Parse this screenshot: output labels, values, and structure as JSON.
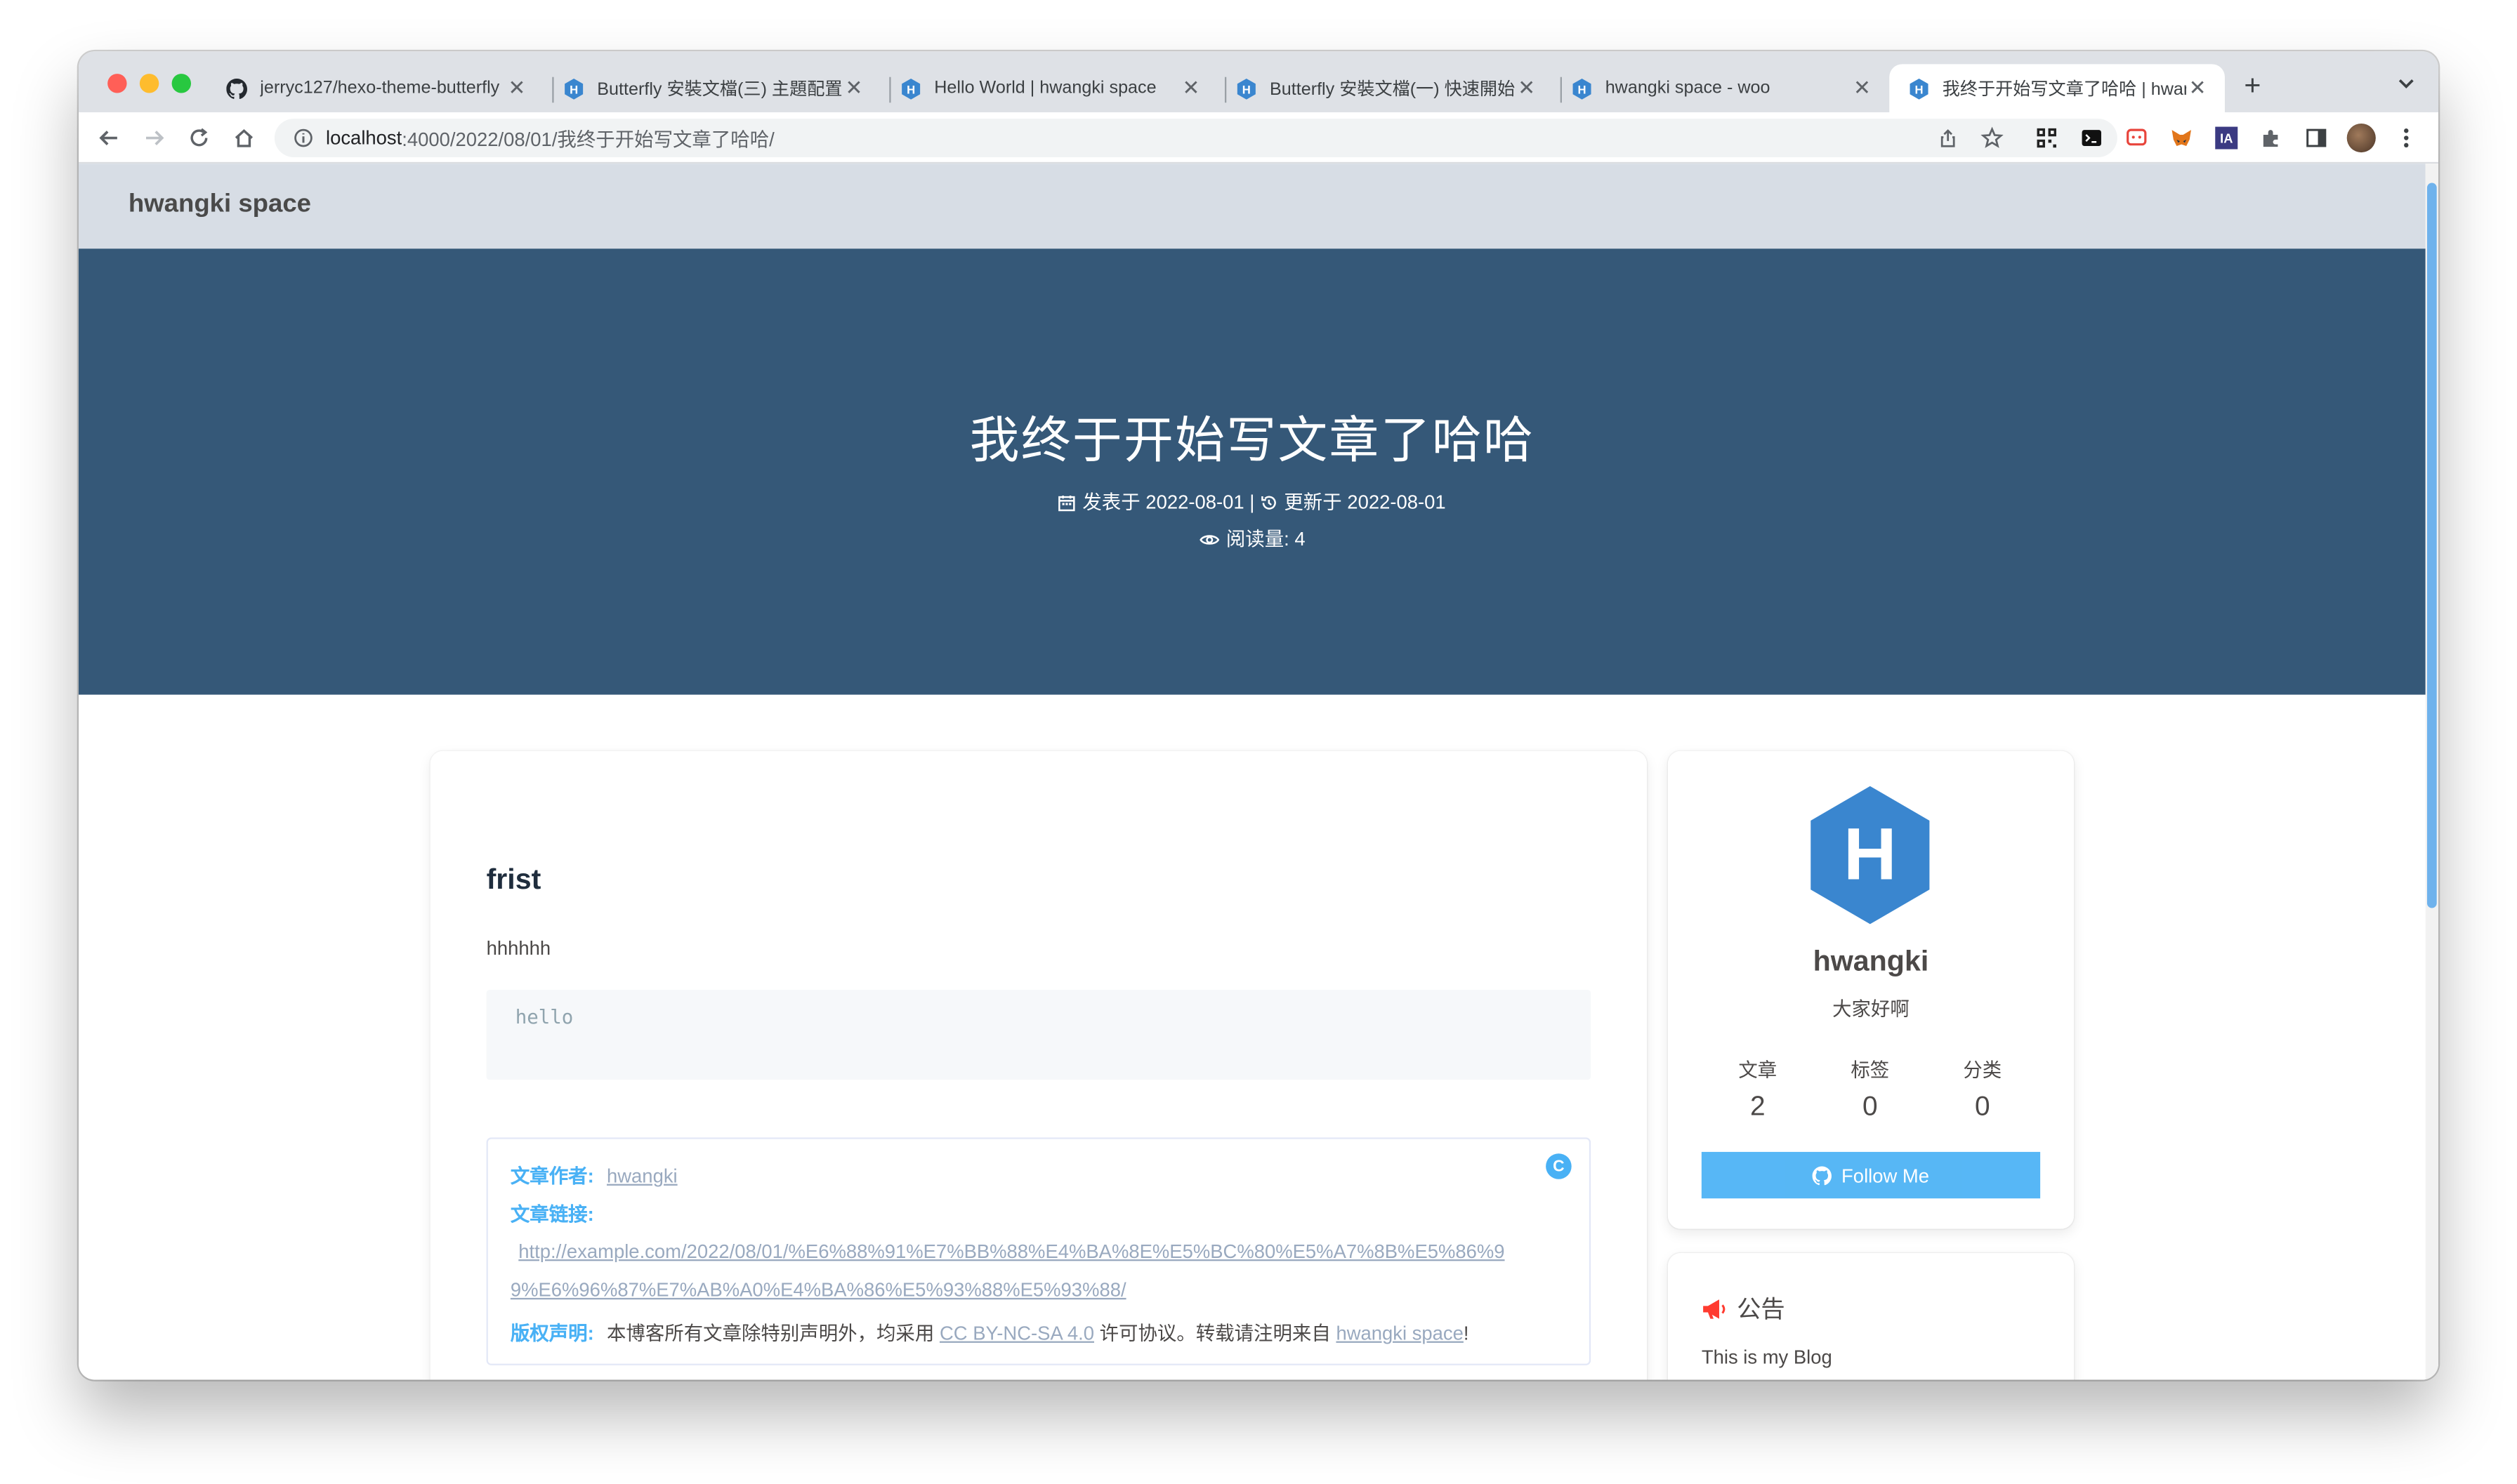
{
  "browser": {
    "tabs": [
      {
        "title": "jerryc127/hexo-theme-butterfly",
        "icon": "github-icon",
        "active": false
      },
      {
        "title": "Butterfly 安裝文檔(三) 主題配置",
        "icon": "hexo-icon",
        "active": false
      },
      {
        "title": "Hello World | hwangki space",
        "icon": "hexo-icon",
        "active": false
      },
      {
        "title": "Butterfly 安裝文檔(一) 快速開始",
        "icon": "hexo-icon",
        "active": false
      },
      {
        "title": "hwangki space - woo",
        "icon": "hexo-icon",
        "active": false
      },
      {
        "title": "我终于开始写文章了哈哈 | hwangki space",
        "icon": "hexo-icon",
        "active": true
      }
    ],
    "url_host": "localhost",
    "url_path": ":4000/2022/08/01/我终于开始写文章了哈哈/"
  },
  "site": {
    "brand": "hwangki space"
  },
  "hero": {
    "title": "我终于开始写文章了哈哈",
    "posted_label": "发表于",
    "posted_date": "2022-08-01",
    "separator": "|",
    "updated_label": "更新于",
    "updated_date": "2022-08-01",
    "views_label": "阅读量:",
    "views_count": "4"
  },
  "post": {
    "heading": "frist",
    "paragraph": "hhhhhh",
    "code": "hello",
    "copyright": {
      "author_label": "文章作者:",
      "author_value": "hwangki",
      "link_label": "文章链接:",
      "link_line1": "http://example.com/2022/08/01/%E6%88%91%E7%BB%88%E4%BA%8E%E5%BC%80%E5%A7%8B%E5%86%9",
      "link_line2": "9%E6%96%87%E7%AB%A0%E4%BA%86%E5%93%88%E5%93%88/",
      "license_label": "版权声明:",
      "license_text_1": "本博客所有文章除特别声明外，均采用",
      "license_link": "CC BY-NC-SA 4.0",
      "license_text_2": "许可协议。转载请注明来自",
      "license_site": "hwangki space",
      "license_end": "!",
      "badge": "C"
    }
  },
  "author": {
    "avatar_letter": "H",
    "name": "hwangki",
    "description": "大家好啊",
    "stats": [
      {
        "label": "文章",
        "value": "2"
      },
      {
        "label": "标签",
        "value": "0"
      },
      {
        "label": "分类",
        "value": "0"
      }
    ],
    "follow_label": "Follow Me"
  },
  "announcement": {
    "title": "公告",
    "text": "This is my Blog"
  },
  "colors": {
    "hero_bg": "#355878",
    "nav_bg": "#d7dde5",
    "accent": "#49b1f5",
    "avatar_blue": "#3a86cf",
    "announce_red": "#ff3b30"
  }
}
